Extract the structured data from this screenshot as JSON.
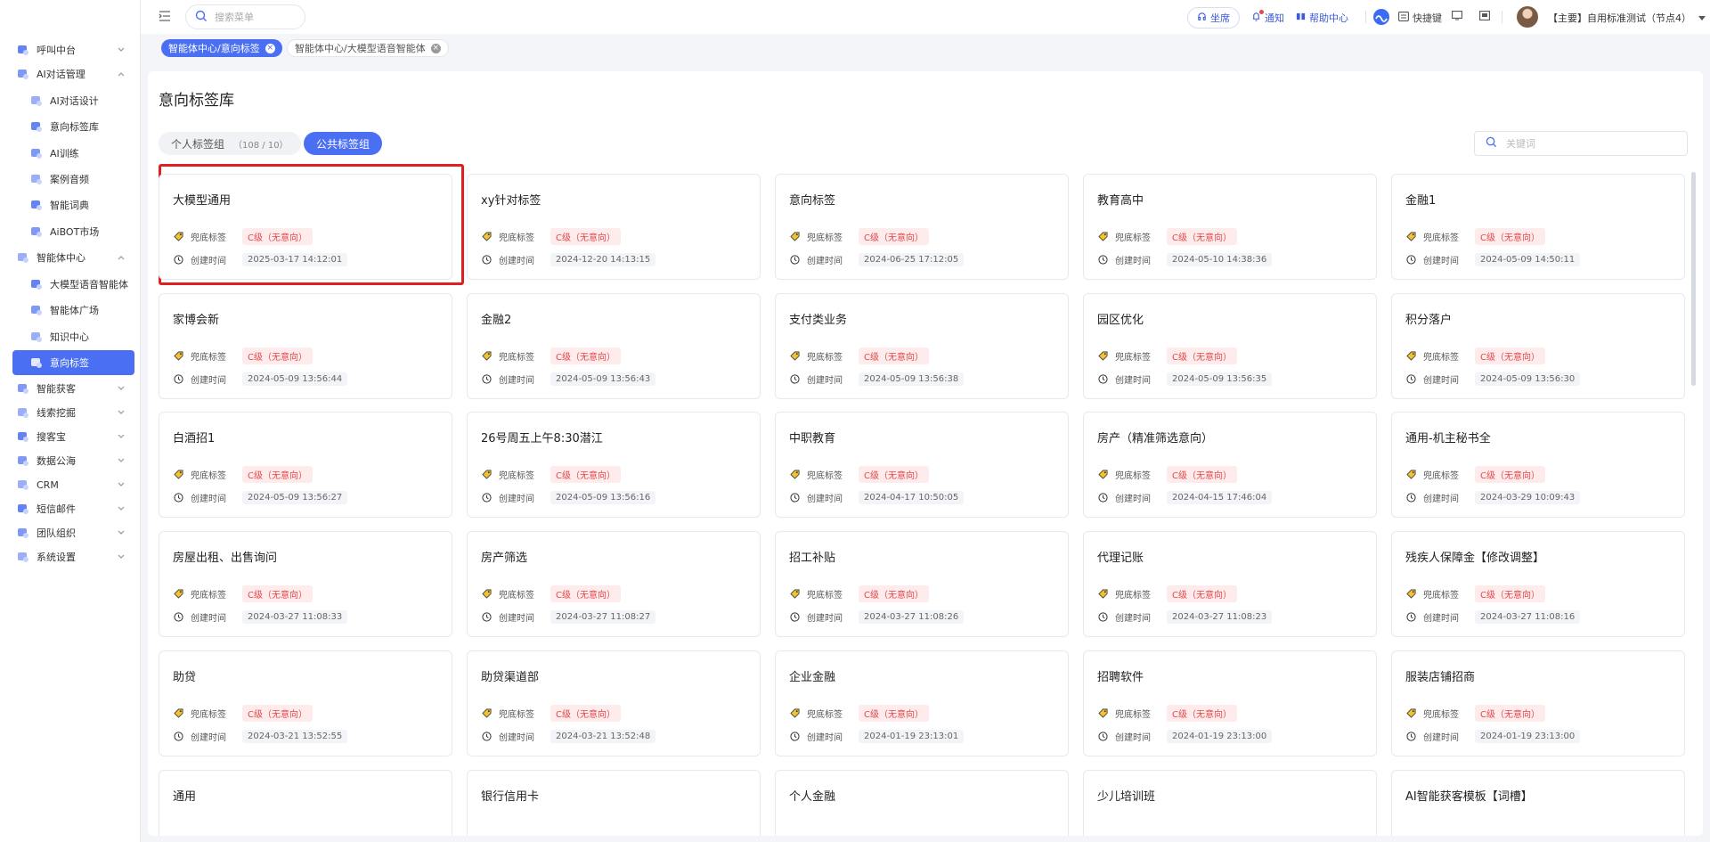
{
  "sidebar": {
    "items": [
      {
        "label": "呼叫中台",
        "icon": "headset-icon",
        "level": 0,
        "chevron": "down"
      },
      {
        "label": "AI对话管理",
        "icon": "ai-chat-icon",
        "level": 0,
        "chevron": "up"
      },
      {
        "label": "AI对话设计",
        "icon": "ai-design-icon",
        "level": 1
      },
      {
        "label": "意向标签库",
        "icon": "tag-library-icon",
        "level": 1
      },
      {
        "label": "AI训练",
        "icon": "gear-training-icon",
        "level": 1
      },
      {
        "label": "案例音频",
        "icon": "folder-audio-icon",
        "level": 1
      },
      {
        "label": "智能词典",
        "icon": "dictionary-icon",
        "level": 1
      },
      {
        "label": "AiBOT市场",
        "icon": "market-icon",
        "level": 1
      },
      {
        "label": "智能体中心",
        "icon": "agent-center-icon",
        "level": 0,
        "chevron": "up"
      },
      {
        "label": "大模型语音智能体",
        "icon": "voice-agent-icon",
        "level": 1
      },
      {
        "label": "智能体广场",
        "icon": "agent-square-icon",
        "level": 1
      },
      {
        "label": "知识中心",
        "icon": "knowledge-icon",
        "level": 1
      },
      {
        "label": "意向标签",
        "icon": "tag-icon",
        "level": 1,
        "active": true
      },
      {
        "label": "智能获客",
        "icon": "customer-icon",
        "level": 0,
        "chevron": "down"
      },
      {
        "label": "线索挖掘",
        "icon": "clue-icon",
        "level": 0,
        "chevron": "down"
      },
      {
        "label": "搜客宝",
        "icon": "search-customer-icon",
        "level": 0,
        "chevron": "down"
      },
      {
        "label": "数据公海",
        "icon": "data-sea-icon",
        "level": 0,
        "chevron": "down"
      },
      {
        "label": "CRM",
        "icon": "crm-icon",
        "level": 0,
        "chevron": "down"
      },
      {
        "label": "短信邮件",
        "icon": "sms-icon",
        "level": 0,
        "chevron": "down"
      },
      {
        "label": "团队组织",
        "icon": "team-icon",
        "level": 0,
        "chevron": "down"
      },
      {
        "label": "系统设置",
        "icon": "settings-icon",
        "level": 0,
        "chevron": "down"
      }
    ]
  },
  "topbar": {
    "search_placeholder": "搜索菜单",
    "seat_label": "坐席",
    "notify_label": "通知",
    "help_label": "帮助中心",
    "shortcut_label": "快捷键",
    "user_label": "【主要】自用标准测试（节点4）"
  },
  "tagbar": {
    "tags": [
      {
        "label": "智能体中心/意向标签",
        "active": true
      },
      {
        "label": "智能体中心/大模型语音智能体",
        "active": false
      }
    ]
  },
  "main": {
    "title": "意向标签库",
    "tabs": [
      {
        "label": "个人标签组",
        "count": "（108 / 10）",
        "active": false
      },
      {
        "label": "公共标签组",
        "active": true
      }
    ],
    "keyword_placeholder": "关键词",
    "row_label_fallback": "兜底标签",
    "row_label_created": "创建时间",
    "fallback_value": "C级（无意向）",
    "cards": [
      {
        "title": "大模型通用",
        "time": "2025-03-17 14:12:01"
      },
      {
        "title": "xy针对标签",
        "time": "2024-12-20 14:13:15"
      },
      {
        "title": "意向标签",
        "time": "2024-06-25 17:12:05"
      },
      {
        "title": "教育高中",
        "time": "2024-05-10 14:38:36"
      },
      {
        "title": "金融1",
        "time": "2024-05-09 14:50:11"
      },
      {
        "title": "家博会新",
        "time": "2024-05-09 13:56:44"
      },
      {
        "title": "金融2",
        "time": "2024-05-09 13:56:43"
      },
      {
        "title": "支付类业务",
        "time": "2024-05-09 13:56:38"
      },
      {
        "title": "园区优化",
        "time": "2024-05-09 13:56:35"
      },
      {
        "title": "积分落户",
        "time": "2024-05-09 13:56:30"
      },
      {
        "title": "白酒招1",
        "time": "2024-05-09 13:56:27"
      },
      {
        "title": "26号周五上午8:30潜江",
        "time": "2024-05-09 13:56:16"
      },
      {
        "title": "中职教育",
        "time": "2024-04-17 10:50:05"
      },
      {
        "title": "房产（精准筛选意向）",
        "time": "2024-04-15 17:46:04"
      },
      {
        "title": "通用-机主秘书全",
        "time": "2024-03-29 10:09:43"
      },
      {
        "title": "房屋出租、出售询问",
        "time": "2024-03-27 11:08:33"
      },
      {
        "title": "房产筛选",
        "time": "2024-03-27 11:08:27"
      },
      {
        "title": "招工补贴",
        "time": "2024-03-27 11:08:26"
      },
      {
        "title": "代理记账",
        "time": "2024-03-27 11:08:23"
      },
      {
        "title": "残疾人保障金【修改调整】",
        "time": "2024-03-27 11:08:16"
      },
      {
        "title": "助贷",
        "time": "2024-03-21 13:52:55"
      },
      {
        "title": "助贷渠道部",
        "time": "2024-03-21 13:52:48"
      },
      {
        "title": "企业金融",
        "time": "2024-01-19 23:13:01"
      },
      {
        "title": "招聘软件",
        "time": "2024-01-19 23:13:00"
      },
      {
        "title": "服装店铺招商",
        "time": "2024-01-19 23:13:00"
      },
      {
        "title": "通用"
      },
      {
        "title": "银行信用卡"
      },
      {
        "title": "个人金融"
      },
      {
        "title": "少儿培训班"
      },
      {
        "title": "AI智能获客模板【词槽】"
      }
    ]
  },
  "colors": {
    "accent": "#4a6ff2",
    "danger": "#e5484d",
    "highlight_box": "#e02020"
  }
}
